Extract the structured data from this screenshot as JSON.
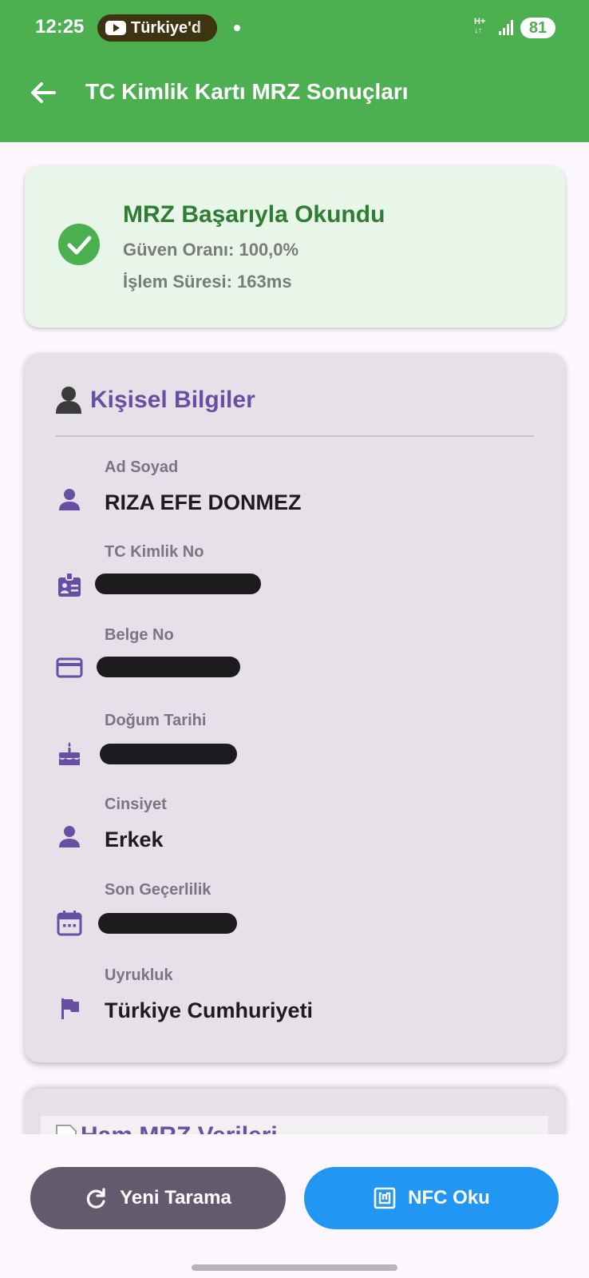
{
  "status_bar": {
    "time": "12:25",
    "app_chip": "Türkiye'd",
    "network": "H+",
    "battery": "81"
  },
  "app_bar": {
    "title": "TC Kimlik Kartı MRZ Sonuçları",
    "back_icon": "arrow-left-icon"
  },
  "success": {
    "title": "MRZ Başarıyla Okundu",
    "confidence": "Güven Oranı: 100,0%",
    "duration": "İşlem Süresi: 163ms",
    "icon": "check-circle-icon",
    "color": "#2e7d32"
  },
  "personal": {
    "header": "Kişisel Bilgiler",
    "header_icon": "person-silhouette-icon",
    "fields": [
      {
        "label": "Ad Soyad",
        "value": "RIZA EFE DONMEZ",
        "icon": "person-icon"
      },
      {
        "label": "TC Kimlik No",
        "value": "",
        "icon": "id-badge-icon",
        "redacted": true
      },
      {
        "label": "Belge No",
        "value": "",
        "icon": "credit-card-icon",
        "redacted": true
      },
      {
        "label": "Doğum Tarihi",
        "value": "",
        "icon": "cake-icon",
        "redacted": true
      },
      {
        "label": "Cinsiyet",
        "value": "Erkek",
        "icon": "person-icon"
      },
      {
        "label": "Son Geçerlilik",
        "value": "",
        "icon": "calendar-icon",
        "redacted": true
      },
      {
        "label": "Uyrukluk",
        "value": "Türkiye Cumhuriyeti",
        "icon": "flag-icon"
      }
    ]
  },
  "raw_mrz": {
    "header": "Ham MRZ Verileri"
  },
  "actions": {
    "new_scan": "Yeni Tarama",
    "nfc_read": "NFC Oku"
  },
  "colors": {
    "app_bar": "#4caf50",
    "accent": "#6750a4",
    "nfc_button": "#2196f3",
    "new_scan_button": "#635a6e"
  }
}
